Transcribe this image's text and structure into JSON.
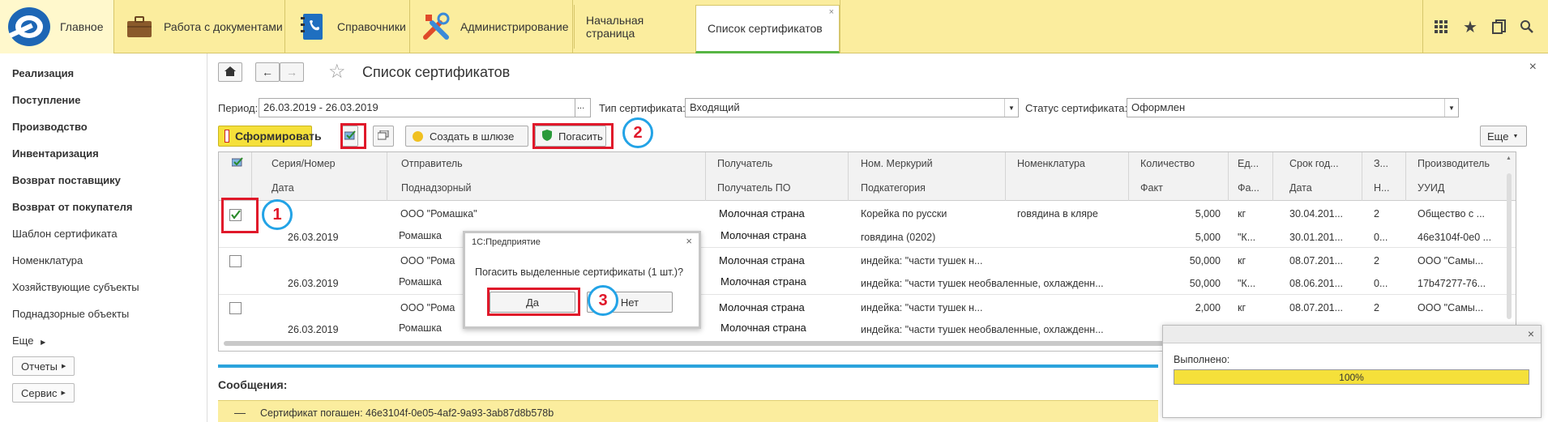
{
  "topbar": {
    "main_label": "Главное",
    "sections": [
      {
        "label": "Работа с документами",
        "icon": "briefcase-icon"
      },
      {
        "label": "Справочники",
        "icon": "phonebook-icon"
      },
      {
        "label": "Администрирование",
        "icon": "tools-icon"
      }
    ],
    "open_tabs": [
      {
        "label": "Начальная страница"
      },
      {
        "label": "Список сертификатов",
        "close": "×"
      }
    ],
    "icons": [
      "grid-icon",
      "star-icon",
      "history-icon",
      "search-icon"
    ]
  },
  "sidebar": {
    "items_bold": [
      "Реализация",
      "Поступление",
      "Производство",
      "Инвентаризация",
      "Возврат поставщику",
      "Возврат от покупателя"
    ],
    "items": [
      "Шаблон сертификата",
      "Номенклатура",
      "Хозяйствующие субъекты",
      "Поднадзорные объекты"
    ],
    "more": "Еще",
    "reports": "Отчеты",
    "service": "Сервис"
  },
  "form": {
    "title": "Список сертификатов",
    "close": "×",
    "period_label": "Период:",
    "period_value": "26.03.2019 - 26.03.2019",
    "period_btn": "...",
    "type_label": "Тип сертификата:",
    "type_value": "Входящий",
    "status_label": "Статус сертификата:",
    "status_value": "Оформлен",
    "btn_generate": "Сформировать",
    "btn_gateway": "Создать в шлюзе",
    "btn_redeem": "Погасить",
    "btn_more": "Еще"
  },
  "table": {
    "headers_row1": [
      "Серия/Номер",
      "Отправитель",
      "Получатель",
      "Ном. Меркурий",
      "Номенклатура",
      "Количество",
      "Ед...",
      "Срок год...",
      "З...",
      "Производитель"
    ],
    "headers_row2": [
      "Дата",
      "Поднадзорный",
      "Получатель ПО",
      "Подкатегория",
      "Факт",
      "Фа...",
      "Дата",
      "Н...",
      "УУИД"
    ],
    "rows": [
      {
        "checked": true,
        "sender": "ООО \"Ромашка\"",
        "receiver": "Молочная страна",
        "merc": "Корейка по русски",
        "nom": "говядина в кляре",
        "qty": "5,000",
        "unit": "кг",
        "exp": "30.04.201...",
        "z": "2",
        "manuf": "Общество с ...",
        "date": "26.03.2019",
        "sub": "Ромашка",
        "receiver_po": "Молочная страна",
        "subcat": "говядина (0202)",
        "fact": "5,000",
        "fa": "\"К...",
        "date2": "30.01.201...",
        "n": "0...",
        "uuid": "46e3104f-0e0 ..."
      },
      {
        "checked": false,
        "sender": "ООО \"Рома",
        "receiver": "Молочная страна",
        "merc": "индейка: \"части тушек н...",
        "nom": "",
        "qty": "50,000",
        "unit": "кг",
        "exp": "08.07.201...",
        "z": "2",
        "manuf": "ООО \"Самы...",
        "date": "26.03.2019",
        "sub": "Ромашка",
        "receiver_po": "Молочная страна",
        "subcat": "индейка: \"части тушек необваленные, охлажденн...",
        "fact": "50,000",
        "fa": "\"К...",
        "date2": "08.06.201...",
        "n": "0...",
        "uuid": "17b47277-76..."
      },
      {
        "checked": false,
        "sender": "ООО \"Рома",
        "receiver": "Молочная страна",
        "merc": "индейка: \"части тушек н...",
        "nom": "",
        "qty": "2,000",
        "unit": "кг",
        "exp": "08.07.201...",
        "z": "2",
        "manuf": "ООО \"Самы...",
        "date": "26.03.2019",
        "sub": "Ромашка",
        "receiver_po": "Молочная страна",
        "subcat": "индейка: \"части тушек необваленные, охлажденн...",
        "fact": "",
        "fa": "",
        "date2": "",
        "n": "",
        "uuid": ""
      }
    ]
  },
  "messages": {
    "title": "Сообщения:",
    "dash": "—",
    "text": "Сертификат погашен: 46e3104f-0e05-4af2-9a93-3ab87d8b578b"
  },
  "dialog": {
    "title": "1С:Предприятие",
    "close": "×",
    "text": "Погасить выделенные сертификаты (1 шт.)?",
    "yes": "Да",
    "no": "Нет"
  },
  "progress": {
    "label": "Выполнено:",
    "percent": 100,
    "percent_text": "100%",
    "close": "×"
  },
  "annotations": [
    "1",
    "2",
    "3"
  ],
  "colors": {
    "accent_yellow": "#fbed9e",
    "button_yellow": "#f5e03a",
    "annotation_red": "#e0182a",
    "annotation_blue": "#23a3e6",
    "message_blue": "#2ba3dc"
  }
}
